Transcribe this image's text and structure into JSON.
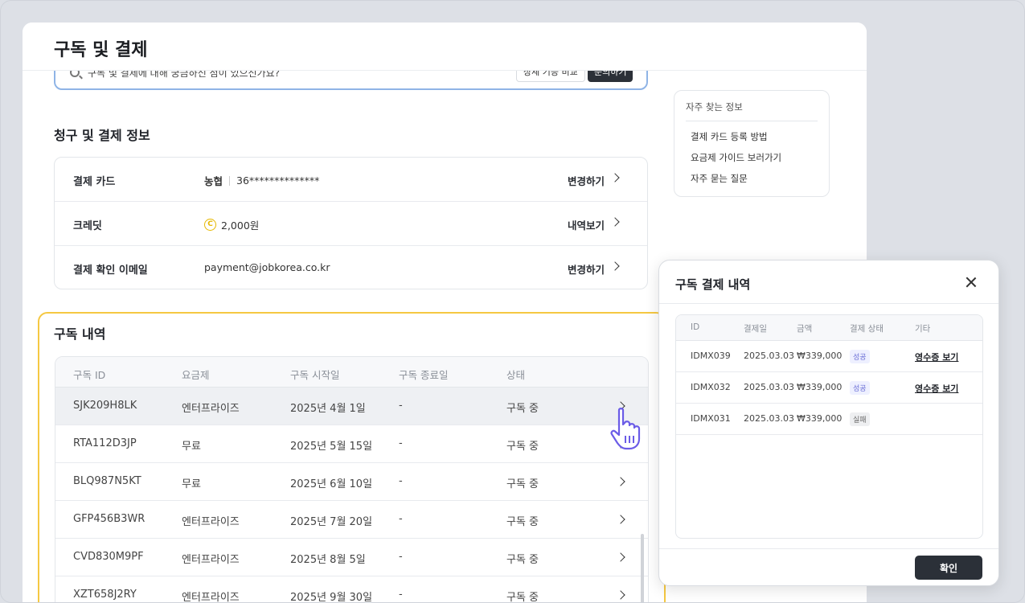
{
  "page": {
    "title": "구독 및 결제"
  },
  "search": {
    "text": "구독 및 결제에 대해 궁금하신 점이 있으신가요?",
    "compare_label": "상세 기능 비교",
    "inquiry_label": "문의하기"
  },
  "billing": {
    "title": "청구 및 결제 정보",
    "card": {
      "label": "결제 카드",
      "bank": "농협",
      "number": "36**************",
      "action": "변경하기"
    },
    "credit": {
      "label": "크레딧",
      "icon": "coin-icon",
      "amount": "2,000원",
      "action": "내역보기"
    },
    "email": {
      "label": "결제 확인 이메일",
      "value": "payment@jobkorea.co.kr",
      "action": "변경하기"
    }
  },
  "faq": {
    "title": "자주 찾는 정보",
    "items": [
      "결제 카드 등록 방법",
      "요금제 가이드 보러가기",
      "자주 묻는 질문"
    ]
  },
  "subscriptions": {
    "title": "구독 내역",
    "headers": [
      "구독 ID",
      "요금제",
      "구독 시작일",
      "구독 종료일",
      "상태"
    ],
    "rows": [
      {
        "id": "SJK209H8LK",
        "plan": "엔터프라이즈",
        "start": "2025년 4월 1일",
        "end": "-",
        "status": "구독 중"
      },
      {
        "id": "RTA112D3JP",
        "plan": "무료",
        "start": "2025년 5월 15일",
        "end": "-",
        "status": "구독 중"
      },
      {
        "id": "BLQ987N5KT",
        "plan": "무료",
        "start": "2025년 6월 10일",
        "end": "-",
        "status": "구독 중"
      },
      {
        "id": "GFP456B3WR",
        "plan": "엔터프라이즈",
        "start": "2025년 7월 20일",
        "end": "-",
        "status": "구독 중"
      },
      {
        "id": "CVD830M9PF",
        "plan": "엔터프라이즈",
        "start": "2025년 8월 5일",
        "end": "-",
        "status": "구독 중"
      },
      {
        "id": "XZT658J2RY",
        "plan": "엔터프라이즈",
        "start": "2025년 9월 30일",
        "end": "-",
        "status": "구독 중"
      }
    ]
  },
  "modal": {
    "title": "구독 결제 내역",
    "headers": [
      "ID",
      "결제일",
      "금액",
      "결제 상태",
      "기타"
    ],
    "rows": [
      {
        "id": "IDMX039",
        "date": "2025.03.03",
        "amount": "₩339,000",
        "status": "성공",
        "other": "영수증 보기"
      },
      {
        "id": "IDMX032",
        "date": "2025.03.03",
        "amount": "₩339,000",
        "status": "성공",
        "other": "영수증 보기"
      },
      {
        "id": "IDMX031",
        "date": "2025.03.03",
        "amount": "₩339,000",
        "status": "실패",
        "other": ""
      }
    ],
    "confirm_label": "확인"
  },
  "colors": {
    "accent_dark": "#2b3038",
    "highlight": "#f5c842",
    "search_border": "#8fb4e6",
    "success_badge": "#6b6fd6"
  }
}
